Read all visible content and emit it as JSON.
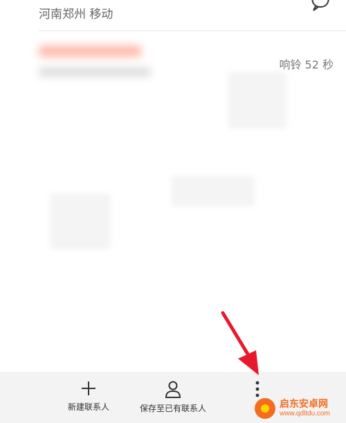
{
  "call_detail": {
    "location": "河南郑州 移动",
    "ring_duration": "响铃 52 秒"
  },
  "toolbar": {
    "new_contact_label": "新建联系人",
    "save_existing_label": "保存至已有联系人",
    "more_label": ""
  },
  "watermark": {
    "title": "启东安卓网",
    "url": "www.qdltdu.com"
  },
  "colors": {
    "toolbar_bg": "#f3f3f3",
    "arrow": "#e8192c",
    "watermark_orange": "#f36c21"
  }
}
